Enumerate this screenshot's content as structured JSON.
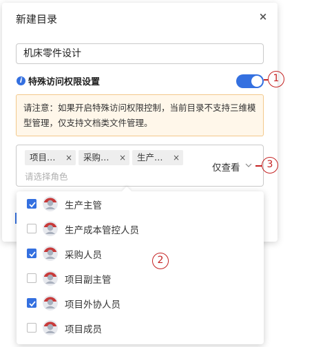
{
  "dialog": {
    "title": "新建目录",
    "close_glyph": "×",
    "name_value": "机床零件设计",
    "info_glyph": "i",
    "permission_label": "特殊访问权限设置",
    "permission_enabled": true,
    "notice_text": "请注意：如果开启特殊访问权限控制，当前目录不支持三维模型管理，仅支持文档类文件管理。",
    "role_select": {
      "tags": [
        "项目…",
        "采购…",
        "生产…"
      ],
      "remove_glyph": "×",
      "placeholder": "请选择角色",
      "view_mode": "仅查看"
    }
  },
  "dropdown": {
    "options": [
      {
        "label": "生产主管",
        "checked": true
      },
      {
        "label": "生产成本管控人员",
        "checked": false
      },
      {
        "label": "采购人员",
        "checked": true
      },
      {
        "label": "项目副主管",
        "checked": false
      },
      {
        "label": "项目外协人员",
        "checked": true
      },
      {
        "label": "项目成员",
        "checked": false
      }
    ]
  },
  "callouts": [
    "1",
    "2",
    "3"
  ],
  "colors": {
    "accent": "#3470e0",
    "callout": "#c42020",
    "notice_bg": "#fff7ea",
    "notice_border": "#f3c88a"
  },
  "icons": {
    "close": "close-icon",
    "info": "info-icon",
    "chevron": "chevron-down-icon",
    "avatar": "user-avatar-icon",
    "check": "check-icon"
  }
}
